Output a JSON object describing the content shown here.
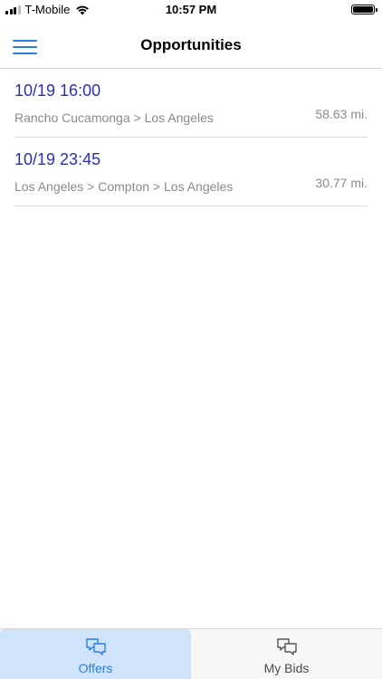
{
  "status_bar": {
    "carrier": "T-Mobile",
    "time": "10:57 PM",
    "icons": [
      "signal-icon",
      "wifi-icon",
      "battery-icon"
    ]
  },
  "nav": {
    "title": "Opportunities",
    "menu_icon": "hamburger-menu-icon"
  },
  "opportunities": [
    {
      "time": "10/19 16:00",
      "route": "Rancho Cucamonga > Los Angeles",
      "distance": "58.63 mi."
    },
    {
      "time": "10/19 23:45",
      "route": "Los Angeles > Compton > Los Angeles",
      "distance": "30.77 mi."
    }
  ],
  "tabs": [
    {
      "label": "Offers",
      "icon": "chat-bubbles-icon",
      "active": true
    },
    {
      "label": "My Bids",
      "icon": "chat-bubbles-icon",
      "active": false
    }
  ],
  "colors": {
    "accent": "#2a7de1",
    "time_text": "#2b2fb8",
    "secondary_text": "#8a8a8a",
    "active_tab_bg": "#cfe3fb"
  }
}
